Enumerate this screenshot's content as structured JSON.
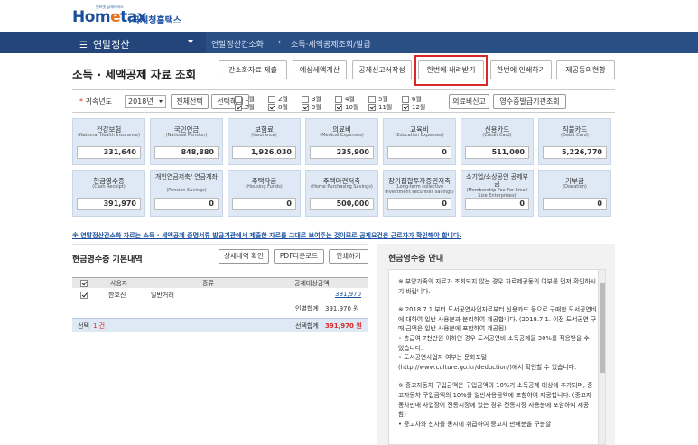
{
  "logo": {
    "tiny": "인터넷 납세서비스",
    "brand_main": "Hom",
    "brand_e": "e",
    "brand_tax": "tax",
    "brand_sub": ".국세청홈택스"
  },
  "nav": {
    "menu": "연말정산",
    "crumbs": [
      "연말정산간소화",
      "소득·세액공제조회/발급"
    ]
  },
  "page": {
    "title": "소득 · 세액공제 자료 조회"
  },
  "tabs": [
    "간소화자료 제출",
    "예상세액계산",
    "공제신고서작성",
    "한번에 내려받기",
    "한번에 인쇄하기",
    "제공동의현황"
  ],
  "filter": {
    "label": "귀속년도",
    "year": "2018년",
    "select_all": "전체선택",
    "deselect": "선택해제",
    "months": [
      "1월",
      "2월",
      "3월",
      "4월",
      "5월",
      "6월",
      "7월",
      "8월",
      "9월",
      "10월",
      "11월",
      "12월"
    ],
    "checked": [
      false,
      false,
      false,
      false,
      false,
      false,
      true,
      true,
      true,
      true,
      true,
      true
    ],
    "medical": "의료비신고",
    "receipt": "영수증발급기관조회"
  },
  "cards": [
    {
      "kr": "건강보험",
      "en": "(National Health Insurance)",
      "val": "331,640"
    },
    {
      "kr": "국민연금",
      "en": "(National Pension)",
      "val": "848,880"
    },
    {
      "kr": "보험료",
      "en": "(Insurance)",
      "val": "1,926,030"
    },
    {
      "kr": "의료비",
      "en": "(Medical Expenses)",
      "val": "235,900"
    },
    {
      "kr": "교육비",
      "en": "(Education Expenses)",
      "val": "0"
    },
    {
      "kr": "신용카드",
      "en": "(Credit Card)",
      "val": "511,000"
    },
    {
      "kr": "직불카드",
      "en": "(Debit Card)",
      "val": "5,226,770"
    },
    {
      "kr": "현금영수증",
      "en": "(Cash Receipt)",
      "val": "391,970"
    },
    {
      "kr": "개인연금저축/ 연금계좌",
      "en": "(Pension Savings)",
      "val": "0"
    },
    {
      "kr": "주택자금",
      "en": "(Housing Funds)",
      "val": "0"
    },
    {
      "kr": "주택마련저축",
      "en": "(Home Purchasing Savings)",
      "val": "500,000"
    },
    {
      "kr": "장기집합투자증권저축",
      "en": "(Long-term collective investment securities savings)",
      "val": "0"
    },
    {
      "kr": "소기업/소상공인 공제부금",
      "en": "(Membership Fee For Small Size Enterprises)",
      "val": "0"
    },
    {
      "kr": "기부금",
      "en": "(Donation)",
      "val": "0"
    }
  ],
  "note": "※ 연말정산간소화 자료는 소득 · 세액공제 증명서류 발급기관에서 제출한 자료를 그대로 보여주는 것이므로 공제요건은 근로자가 확인해야 합니다.",
  "left": {
    "title": "현금영수증 기본내역",
    "buttons": [
      "상세내역 확인",
      "PDF다운로드",
      "인쇄하기"
    ],
    "headers": [
      "사용자",
      "종류",
      "공제대상금액"
    ],
    "rows": [
      {
        "user": "한호진",
        "type": "일반거래",
        "amount": "391,970"
      }
    ],
    "person_total_label": "인별합계",
    "person_total": "391,970 원",
    "selected_label": "선택",
    "selected_count": "1 건",
    "selected_total_label": "선택합계",
    "selected_total": "391,970 원"
  },
  "right": {
    "title": "현금영수증 안내",
    "paras": [
      "※ 부양가족의 자료가 조회되지 않는 경우 자료제공동의 여부를 먼저 확인하시기 바랍니다.",
      "※ 2018.7.1.부터 도서공연사업자로부터 신용카드 등으로 구매한 도서공연비에 대하여 일반 사용분과 분리하여 제공합니다. (2018.7.1. 이전 도서공연 구매 금액은 일반 사용분에 포함하여 제공됨)\n• 총급여 7천만원 이하인 경우 도서공연비 소득공제율 30%를 적용받을 수 있습니다.\n• 도서공연사업자 여부는 문화포털 (http://www.culture.go.kr/deduction/)에서 확인할 수 있습니다.",
      "※ 중고자동차 구입금액은 구입금액의 10%가 소득공제 대상에 추가되며, 중고자동차 구입금액의 10%를 일반사용금액에 포함하여 제공합니다. (중고자동차판매 사업장이 전통시장에 있는 경우 전통시장 사용분에 포함하여 제공함)\n• 중고차와 신차를 동시에 취급하여 중고차 판매분을 구분할"
    ]
  }
}
